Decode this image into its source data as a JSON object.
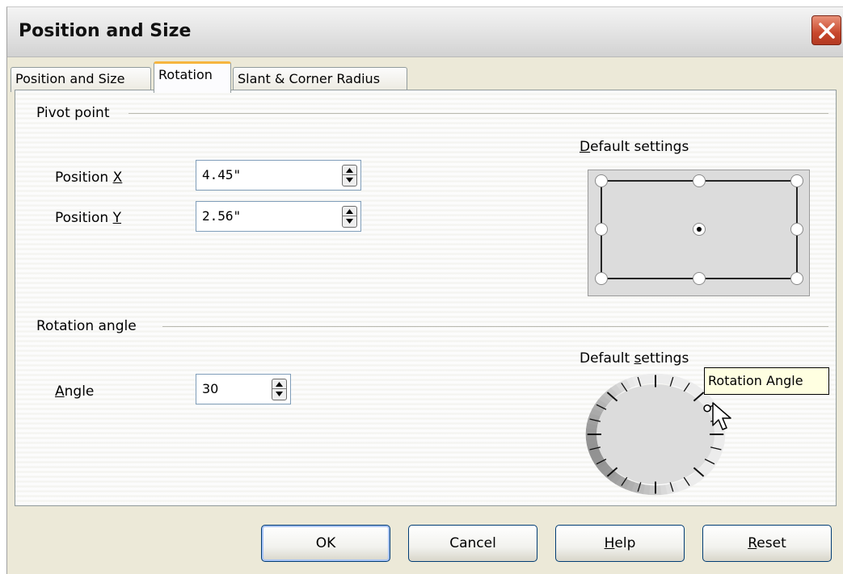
{
  "window": {
    "title": "Position and Size"
  },
  "tabs": [
    {
      "label": "Position and Size",
      "active": false
    },
    {
      "label": "Rotation",
      "active": true
    },
    {
      "label": "Slant & Corner Radius",
      "active": false
    }
  ],
  "pivot": {
    "section_label": "Pivot point",
    "position_x": {
      "label_text": "Position ",
      "label_key": "X",
      "value": "4.45\""
    },
    "position_y": {
      "label_text": "Position ",
      "label_key": "Y",
      "value": "2.56\""
    },
    "default_settings": {
      "label_key": "D",
      "label_rest": "efault settings"
    },
    "selected_point": "center"
  },
  "rotation": {
    "section_label": "Rotation angle",
    "angle": {
      "label_key": "A",
      "label_rest": "ngle",
      "value": "30"
    },
    "default_settings": {
      "label_pre": "Default ",
      "label_key": "s",
      "label_rest": "ettings"
    },
    "angle_degrees": 30
  },
  "tooltip": "Rotation Angle",
  "buttons": {
    "ok": "OK",
    "cancel": "Cancel",
    "help": {
      "key": "H",
      "rest": "elp"
    },
    "reset": {
      "key": "R",
      "rest": "eset"
    }
  },
  "colors": {
    "dialog_bg": "#ece9d8",
    "tab_accent": "#f6b53f",
    "close_red": "#c8472c",
    "tooltip_bg": "#ffffe1"
  }
}
